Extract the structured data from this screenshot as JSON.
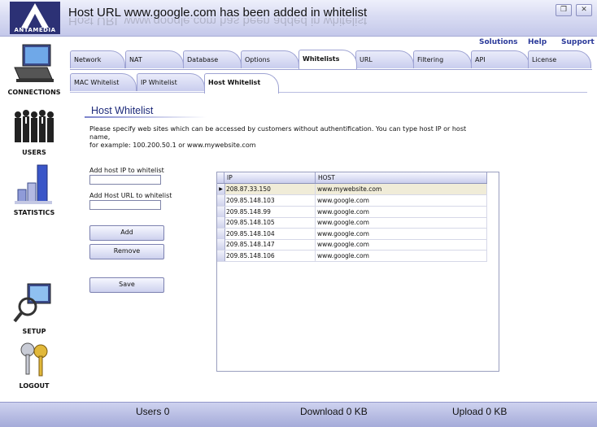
{
  "app": {
    "logo_text": "ANTAMEDIA",
    "title": "Host URL www.google.com has been added in whitelist"
  },
  "top_links": {
    "solutions": "Solutions",
    "help": "Help",
    "support": "Support"
  },
  "sidebar": {
    "items": [
      {
        "label": "CONNECTIONS"
      },
      {
        "label": "USERS"
      },
      {
        "label": "STATISTICS"
      },
      {
        "label": "SETUP"
      },
      {
        "label": "LOGOUT"
      }
    ]
  },
  "tabs": [
    "Network",
    "NAT",
    "Database",
    "Options",
    "Whitelists",
    "URL",
    "Filtering",
    "API",
    "License"
  ],
  "active_tab": "Whitelists",
  "subtabs": [
    "MAC Whitelist",
    "IP Whitelist",
    "Host Whitelist"
  ],
  "active_subtab": "Host Whitelist",
  "section": {
    "title": "Host Whitelist",
    "desc_line1": "Please specify web sites which can be accessed by customers without authentification. You can type host IP or host name,",
    "desc_line2": "for example:  100.200.50.1  or  www.mywebsite.com"
  },
  "form": {
    "ip_label": "Add host IP to whitelist",
    "ip_value": "",
    "url_label": "Add Host URL to whitelist",
    "url_value": "",
    "add": "Add",
    "remove": "Remove",
    "save": "Save"
  },
  "grid": {
    "columns": [
      "IP",
      "HOST"
    ],
    "rows": [
      [
        "208.87.33.150",
        "www.mywebsite.com"
      ],
      [
        "209.85.148.103",
        "www.google.com"
      ],
      [
        "209.85.148.99",
        "www.google.com"
      ],
      [
        "209.85.148.105",
        "www.google.com"
      ],
      [
        "209.85.148.104",
        "www.google.com"
      ],
      [
        "209.85.148.147",
        "www.google.com"
      ],
      [
        "209.85.148.106",
        "www.google.com"
      ]
    ]
  },
  "status": {
    "users_label": "Users",
    "users_value": "0",
    "download_label": "Download",
    "download_value": "0 KB",
    "upload_label": "Upload",
    "upload_value": "0 KB"
  }
}
